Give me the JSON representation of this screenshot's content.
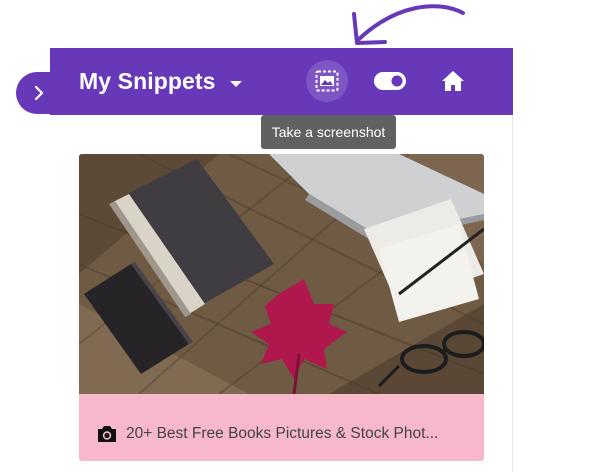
{
  "toolbar": {
    "title": "My Snippets",
    "accent_color": "#6739b9",
    "icons": [
      "chevron-right-icon",
      "caret-down-icon",
      "screenshot-icon",
      "toggle-icon",
      "home-icon"
    ]
  },
  "tooltip": {
    "text": "Take a screenshot"
  },
  "card": {
    "caption": "20+ Best Free Books Pictures & Stock Phot...",
    "caption_icon": "camera-icon",
    "footer_color": "#f7b8cc"
  }
}
